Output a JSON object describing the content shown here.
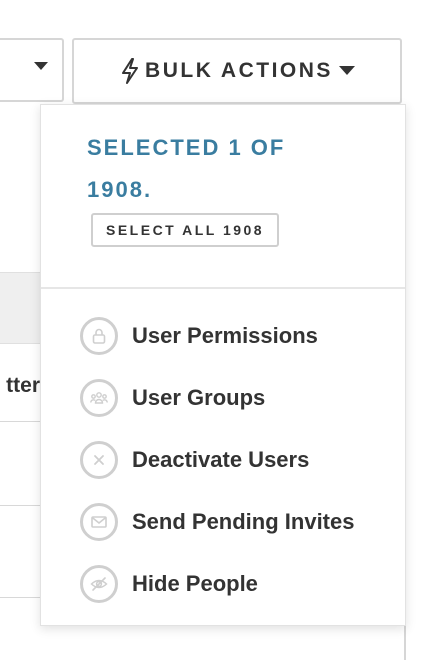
{
  "background": {
    "row_text_fragment": "tter"
  },
  "bulk_actions": {
    "label": "BULK ACTIONS",
    "icon": "lightning-bolt-icon"
  },
  "dropdown": {
    "selected_text": "SELECTED 1 OF 1908.",
    "select_all_label": "SELECT ALL 1908",
    "items": [
      {
        "label": "User Permissions",
        "icon": "lock-icon"
      },
      {
        "label": "User Groups",
        "icon": "people-icon"
      },
      {
        "label": "Deactivate Users",
        "icon": "x-icon"
      },
      {
        "label": "Send Pending Invites",
        "icon": "envelope-icon"
      },
      {
        "label": "Hide People",
        "icon": "eye-slash-icon"
      }
    ]
  },
  "colors": {
    "accent": "#3a7da0",
    "text": "#333333",
    "border": "#d6d6d6",
    "icon_grey": "#cfcfcf"
  }
}
